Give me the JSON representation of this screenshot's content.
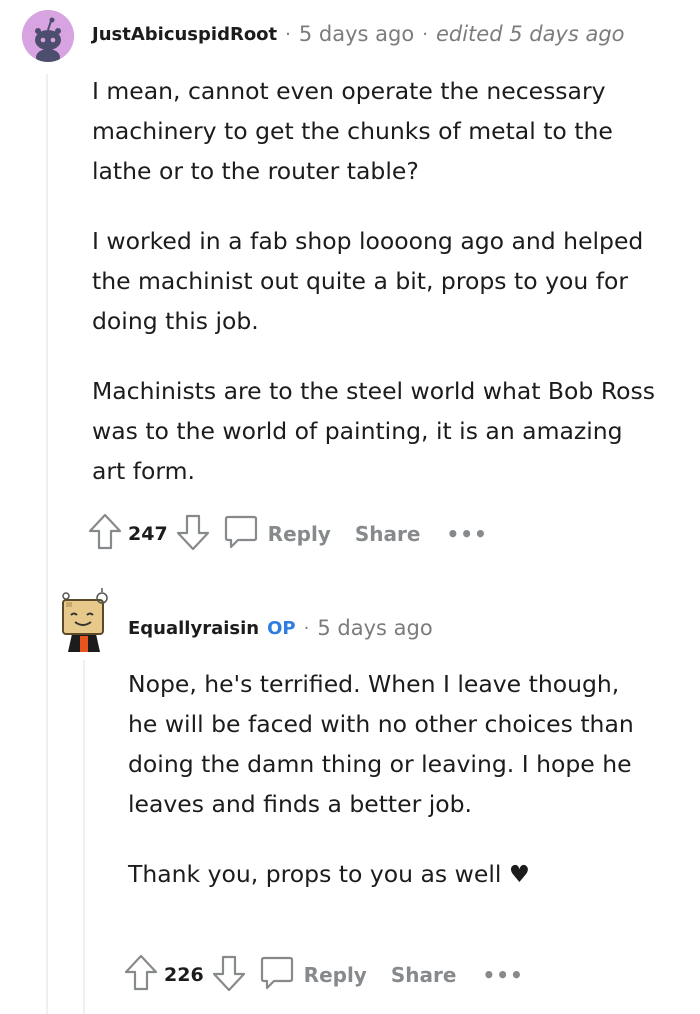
{
  "comments": [
    {
      "author": "JustAbicuspidRoot",
      "separator": "·",
      "time": "5 days ago",
      "edited": "edited 5 days ago",
      "paragraphs": [
        "I mean, cannot even operate the necessary machinery to get the chunks of metal to the lathe or to the router table?",
        "I worked in a fab shop loooong ago and helped the machinist out quite a bit, props to you for doing this job.",
        "Machinists are to the steel world what Bob Ross was to the world of painting, it is an amazing art form."
      ],
      "votes": "247",
      "reply_label": "Reply",
      "share_label": "Share",
      "more_label": "•••"
    },
    {
      "author": "Equallyraisin",
      "badge": "OP",
      "separator": "·",
      "time": "5 days ago",
      "paragraphs": [
        "Nope, he's terrified. When I leave though, he will be faced with no other choices than doing the damn thing or leaving. I hope he leaves and finds a better job.",
        "Thank you, props to you as well ♥"
      ],
      "votes": "226",
      "reply_label": "Reply",
      "share_label": "Share",
      "more_label": "•••"
    }
  ],
  "icons": {
    "upvote": "arrow-up-icon",
    "downvote": "arrow-down-icon",
    "comment": "speech-bubble-icon",
    "avatar1": "reddit-snoo-avatar",
    "avatar2": "box-head-avatar"
  },
  "colors": {
    "op_badge": "#2e7de0",
    "muted": "#7c7c7c",
    "avatar1_bg": "#d7a3e0"
  }
}
